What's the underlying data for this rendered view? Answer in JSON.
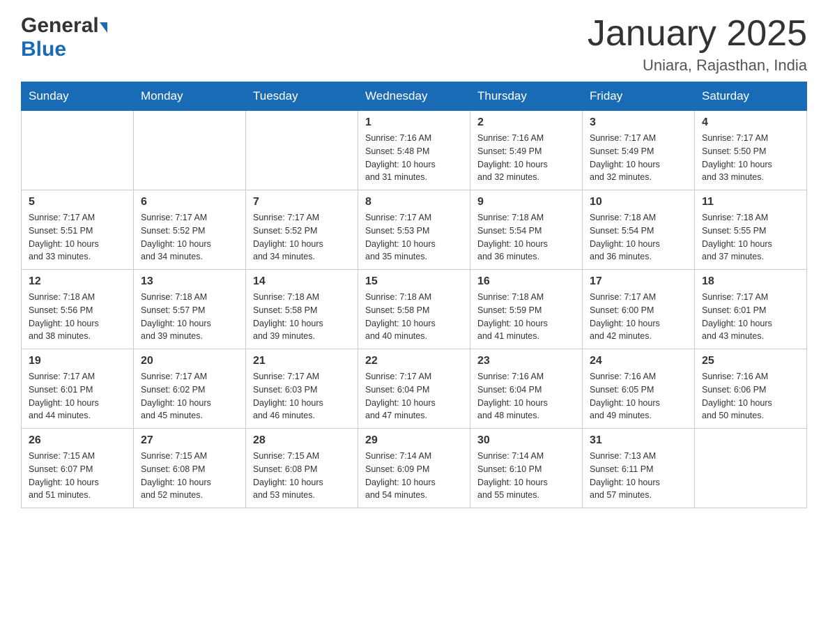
{
  "header": {
    "logo_general": "General",
    "logo_blue": "Blue",
    "title": "January 2025",
    "subtitle": "Uniara, Rajasthan, India"
  },
  "days_of_week": [
    "Sunday",
    "Monday",
    "Tuesday",
    "Wednesday",
    "Thursday",
    "Friday",
    "Saturday"
  ],
  "weeks": [
    [
      {
        "day": "",
        "info": ""
      },
      {
        "day": "",
        "info": ""
      },
      {
        "day": "",
        "info": ""
      },
      {
        "day": "1",
        "info": "Sunrise: 7:16 AM\nSunset: 5:48 PM\nDaylight: 10 hours\nand 31 minutes."
      },
      {
        "day": "2",
        "info": "Sunrise: 7:16 AM\nSunset: 5:49 PM\nDaylight: 10 hours\nand 32 minutes."
      },
      {
        "day": "3",
        "info": "Sunrise: 7:17 AM\nSunset: 5:49 PM\nDaylight: 10 hours\nand 32 minutes."
      },
      {
        "day": "4",
        "info": "Sunrise: 7:17 AM\nSunset: 5:50 PM\nDaylight: 10 hours\nand 33 minutes."
      }
    ],
    [
      {
        "day": "5",
        "info": "Sunrise: 7:17 AM\nSunset: 5:51 PM\nDaylight: 10 hours\nand 33 minutes."
      },
      {
        "day": "6",
        "info": "Sunrise: 7:17 AM\nSunset: 5:52 PM\nDaylight: 10 hours\nand 34 minutes."
      },
      {
        "day": "7",
        "info": "Sunrise: 7:17 AM\nSunset: 5:52 PM\nDaylight: 10 hours\nand 34 minutes."
      },
      {
        "day": "8",
        "info": "Sunrise: 7:17 AM\nSunset: 5:53 PM\nDaylight: 10 hours\nand 35 minutes."
      },
      {
        "day": "9",
        "info": "Sunrise: 7:18 AM\nSunset: 5:54 PM\nDaylight: 10 hours\nand 36 minutes."
      },
      {
        "day": "10",
        "info": "Sunrise: 7:18 AM\nSunset: 5:54 PM\nDaylight: 10 hours\nand 36 minutes."
      },
      {
        "day": "11",
        "info": "Sunrise: 7:18 AM\nSunset: 5:55 PM\nDaylight: 10 hours\nand 37 minutes."
      }
    ],
    [
      {
        "day": "12",
        "info": "Sunrise: 7:18 AM\nSunset: 5:56 PM\nDaylight: 10 hours\nand 38 minutes."
      },
      {
        "day": "13",
        "info": "Sunrise: 7:18 AM\nSunset: 5:57 PM\nDaylight: 10 hours\nand 39 minutes."
      },
      {
        "day": "14",
        "info": "Sunrise: 7:18 AM\nSunset: 5:58 PM\nDaylight: 10 hours\nand 39 minutes."
      },
      {
        "day": "15",
        "info": "Sunrise: 7:18 AM\nSunset: 5:58 PM\nDaylight: 10 hours\nand 40 minutes."
      },
      {
        "day": "16",
        "info": "Sunrise: 7:18 AM\nSunset: 5:59 PM\nDaylight: 10 hours\nand 41 minutes."
      },
      {
        "day": "17",
        "info": "Sunrise: 7:17 AM\nSunset: 6:00 PM\nDaylight: 10 hours\nand 42 minutes."
      },
      {
        "day": "18",
        "info": "Sunrise: 7:17 AM\nSunset: 6:01 PM\nDaylight: 10 hours\nand 43 minutes."
      }
    ],
    [
      {
        "day": "19",
        "info": "Sunrise: 7:17 AM\nSunset: 6:01 PM\nDaylight: 10 hours\nand 44 minutes."
      },
      {
        "day": "20",
        "info": "Sunrise: 7:17 AM\nSunset: 6:02 PM\nDaylight: 10 hours\nand 45 minutes."
      },
      {
        "day": "21",
        "info": "Sunrise: 7:17 AM\nSunset: 6:03 PM\nDaylight: 10 hours\nand 46 minutes."
      },
      {
        "day": "22",
        "info": "Sunrise: 7:17 AM\nSunset: 6:04 PM\nDaylight: 10 hours\nand 47 minutes."
      },
      {
        "day": "23",
        "info": "Sunrise: 7:16 AM\nSunset: 6:04 PM\nDaylight: 10 hours\nand 48 minutes."
      },
      {
        "day": "24",
        "info": "Sunrise: 7:16 AM\nSunset: 6:05 PM\nDaylight: 10 hours\nand 49 minutes."
      },
      {
        "day": "25",
        "info": "Sunrise: 7:16 AM\nSunset: 6:06 PM\nDaylight: 10 hours\nand 50 minutes."
      }
    ],
    [
      {
        "day": "26",
        "info": "Sunrise: 7:15 AM\nSunset: 6:07 PM\nDaylight: 10 hours\nand 51 minutes."
      },
      {
        "day": "27",
        "info": "Sunrise: 7:15 AM\nSunset: 6:08 PM\nDaylight: 10 hours\nand 52 minutes."
      },
      {
        "day": "28",
        "info": "Sunrise: 7:15 AM\nSunset: 6:08 PM\nDaylight: 10 hours\nand 53 minutes."
      },
      {
        "day": "29",
        "info": "Sunrise: 7:14 AM\nSunset: 6:09 PM\nDaylight: 10 hours\nand 54 minutes."
      },
      {
        "day": "30",
        "info": "Sunrise: 7:14 AM\nSunset: 6:10 PM\nDaylight: 10 hours\nand 55 minutes."
      },
      {
        "day": "31",
        "info": "Sunrise: 7:13 AM\nSunset: 6:11 PM\nDaylight: 10 hours\nand 57 minutes."
      },
      {
        "day": "",
        "info": ""
      }
    ]
  ]
}
